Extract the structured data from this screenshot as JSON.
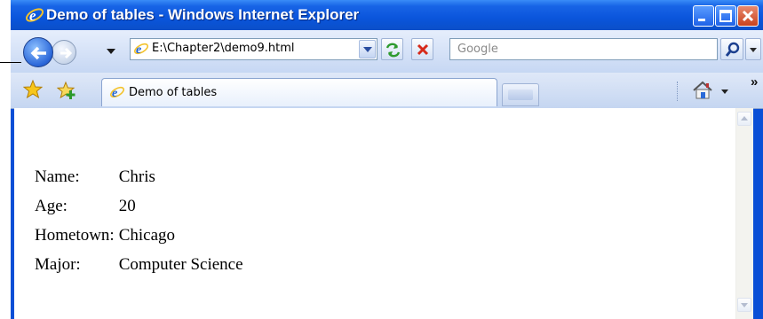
{
  "window": {
    "title": "Demo of tables - Windows Internet Explorer"
  },
  "address_bar": {
    "url": "E:\\Chapter2\\demo9.html"
  },
  "search": {
    "placeholder": "Google"
  },
  "tabs": [
    {
      "label": "Demo of tables"
    }
  ],
  "table": {
    "rows": [
      {
        "label": "Name:",
        "value": "Chris"
      },
      {
        "label": "Age:",
        "value": "20"
      },
      {
        "label": "Hometown:",
        "value": "Chicago"
      },
      {
        "label": "Major:",
        "value": "Computer Science"
      }
    ]
  },
  "colors": {
    "titlebar": "#0a55dc",
    "close_button": "#c8421e",
    "window_frame": "#0a4fd6"
  }
}
